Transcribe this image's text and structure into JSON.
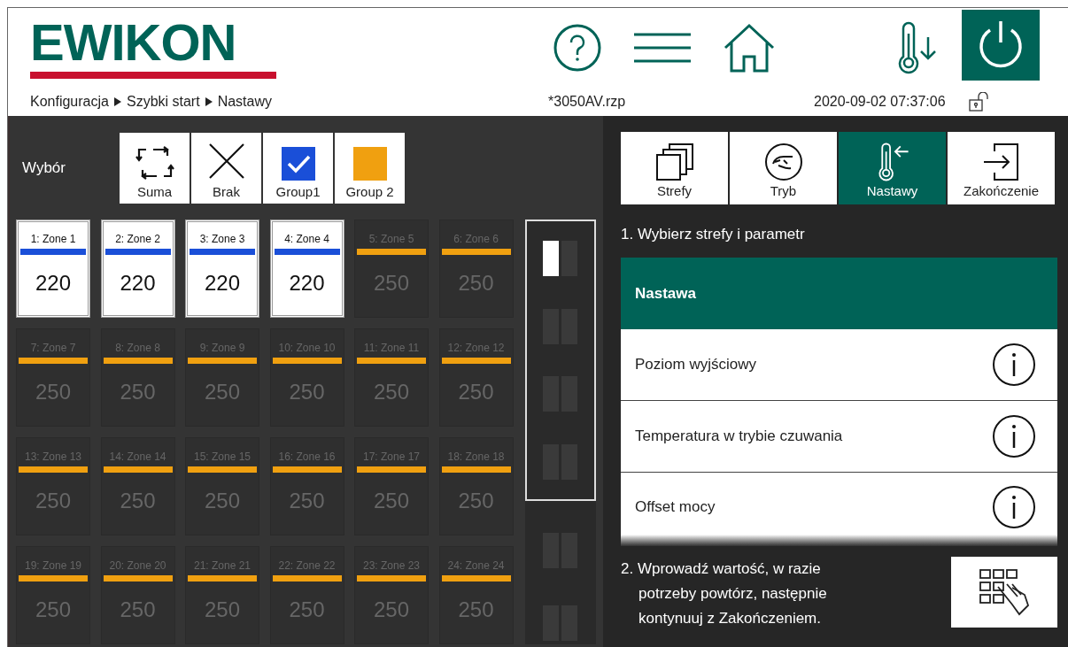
{
  "header": {
    "logo": "EWIKON",
    "breadcrumb": [
      "Konfiguracja",
      "Szybki start",
      "Nastawy"
    ],
    "file": "*3050AV.rzp",
    "datetime": "2020-09-02 07:37:06"
  },
  "selection": {
    "label": "Wybór",
    "buttons": [
      {
        "kind": "all",
        "label": "Suma"
      },
      {
        "kind": "none",
        "label": "Brak"
      },
      {
        "kind": "group",
        "label": "Group1",
        "color": "#1a4fd8",
        "checked": true
      },
      {
        "kind": "group",
        "label": "Group 2",
        "color": "#f0a010",
        "checked": false
      }
    ]
  },
  "zones": [
    {
      "label": "1: Zone 1",
      "value": "220",
      "selected": true,
      "color": "#1a4fd8"
    },
    {
      "label": "2: Zone 2",
      "value": "220",
      "selected": true,
      "color": "#1a4fd8"
    },
    {
      "label": "3: Zone 3",
      "value": "220",
      "selected": true,
      "color": "#1a4fd8"
    },
    {
      "label": "4: Zone 4",
      "value": "220",
      "selected": true,
      "color": "#1a4fd8"
    },
    {
      "label": "5: Zone 5",
      "value": "250",
      "selected": false,
      "color": "#f0a010"
    },
    {
      "label": "6: Zone 6",
      "value": "250",
      "selected": false,
      "color": "#f0a010"
    },
    {
      "label": "7: Zone 7",
      "value": "250",
      "selected": false,
      "color": "#f0a010"
    },
    {
      "label": "8: Zone 8",
      "value": "250",
      "selected": false,
      "color": "#f0a010"
    },
    {
      "label": "9: Zone 9",
      "value": "250",
      "selected": false,
      "color": "#f0a010"
    },
    {
      "label": "10: Zone 10",
      "value": "250",
      "selected": false,
      "color": "#f0a010"
    },
    {
      "label": "11: Zone 11",
      "value": "250",
      "selected": false,
      "color": "#f0a010"
    },
    {
      "label": "12: Zone 12",
      "value": "250",
      "selected": false,
      "color": "#f0a010"
    },
    {
      "label": "13: Zone 13",
      "value": "250",
      "selected": false,
      "color": "#f0a010"
    },
    {
      "label": "14: Zone 14",
      "value": "250",
      "selected": false,
      "color": "#f0a010"
    },
    {
      "label": "15: Zone 15",
      "value": "250",
      "selected": false,
      "color": "#f0a010"
    },
    {
      "label": "16: Zone 16",
      "value": "250",
      "selected": false,
      "color": "#f0a010"
    },
    {
      "label": "17: Zone 17",
      "value": "250",
      "selected": false,
      "color": "#f0a010"
    },
    {
      "label": "18: Zone 18",
      "value": "250",
      "selected": false,
      "color": "#f0a010"
    },
    {
      "label": "19: Zone 19",
      "value": "250",
      "selected": false,
      "color": "#f0a010"
    },
    {
      "label": "20: Zone 20",
      "value": "250",
      "selected": false,
      "color": "#f0a010"
    },
    {
      "label": "21: Zone 21",
      "value": "250",
      "selected": false,
      "color": "#f0a010"
    },
    {
      "label": "22: Zone 22",
      "value": "250",
      "selected": false,
      "color": "#f0a010"
    },
    {
      "label": "23: Zone 23",
      "value": "250",
      "selected": false,
      "color": "#f0a010"
    },
    {
      "label": "24: Zone 24",
      "value": "250",
      "selected": false,
      "color": "#f0a010"
    }
  ],
  "pager": {
    "framed": [
      {
        "selected": true
      },
      {
        "selected": false
      },
      {
        "selected": false
      },
      {
        "selected": false
      }
    ],
    "below": [
      {
        "selected": false
      },
      {
        "selected": false
      }
    ]
  },
  "tabs": [
    {
      "kind": "zones",
      "label": "Strefy",
      "selected": false
    },
    {
      "kind": "mode",
      "label": "Tryb",
      "selected": false
    },
    {
      "kind": "setpoints",
      "label": "Nastawy",
      "selected": true
    },
    {
      "kind": "finish",
      "label": "Zakończenie",
      "selected": false
    }
  ],
  "step1": "1. Wybierz strefy i parametr",
  "parameters": [
    {
      "kind": "header",
      "label": "Nastawa"
    },
    {
      "kind": "param",
      "label": "Poziom wyjściowy"
    },
    {
      "kind": "param",
      "label": "Temperatura w trybie czuwania"
    },
    {
      "kind": "param",
      "label": "Offset mocy"
    }
  ],
  "step2": [
    "2. Wprowadź wartość, w razie",
    "potrzeby powtórz, następnie",
    "kontynuuj z Zakończeniem."
  ]
}
